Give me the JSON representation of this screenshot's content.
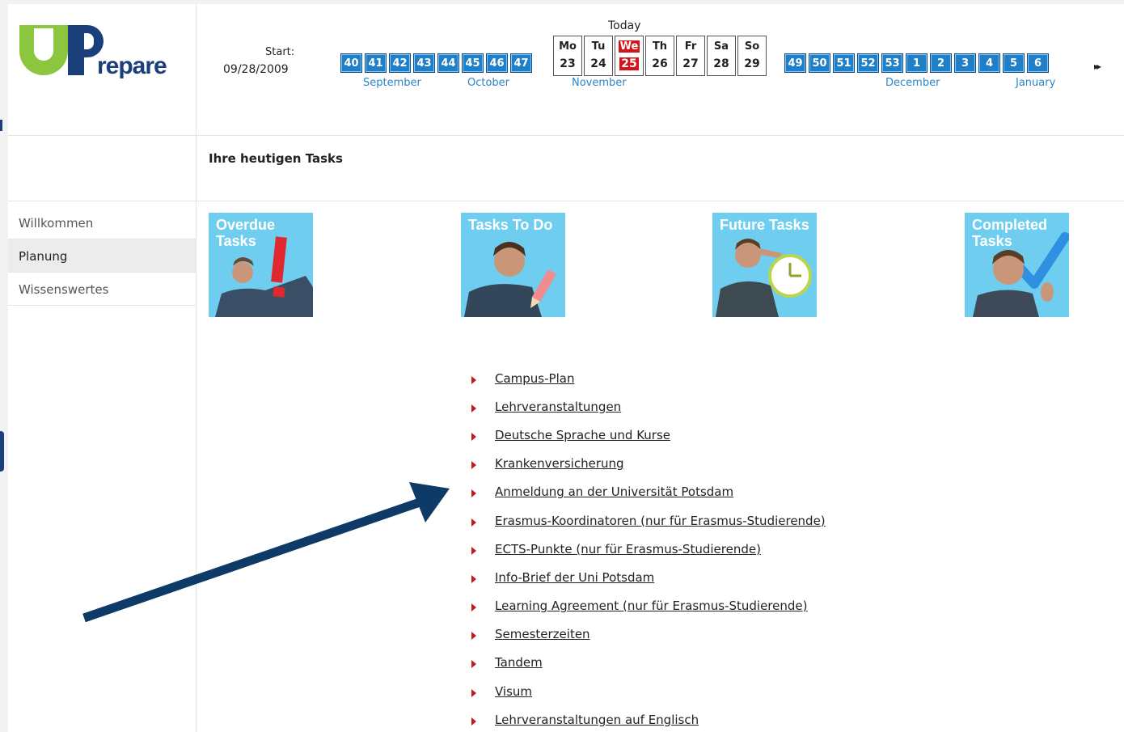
{
  "logo": {
    "letter": "UP",
    "text": "repare"
  },
  "calendar": {
    "start_label": "Start:",
    "start_date": "09/28/2009",
    "today_label": "Today",
    "weeks_before": [
      "40",
      "41",
      "42",
      "43",
      "44",
      "45",
      "46",
      "47"
    ],
    "days": [
      {
        "name": "Mo",
        "date": "23"
      },
      {
        "name": "Tu",
        "date": "24"
      },
      {
        "name": "We",
        "date": "25",
        "today": true
      },
      {
        "name": "Th",
        "date": "26"
      },
      {
        "name": "Fr",
        "date": "27"
      },
      {
        "name": "Sa",
        "date": "28"
      },
      {
        "name": "So",
        "date": "29"
      }
    ],
    "weeks_after": [
      "49",
      "50",
      "51",
      "52",
      "53",
      "1",
      "2",
      "3",
      "4",
      "5",
      "6"
    ],
    "months": [
      "September",
      "October",
      "November",
      "December",
      "January"
    ],
    "next_symbol": "▸▸"
  },
  "sidebar": {
    "items": [
      {
        "label": "Willkommen"
      },
      {
        "label": "Planung",
        "active": true
      },
      {
        "label": "Wissenswertes"
      }
    ]
  },
  "main": {
    "heading": "Ihre heutigen Tasks",
    "tiles": [
      {
        "title": "Overdue Tasks",
        "icon": "exclamation-icon"
      },
      {
        "title": "Tasks To Do",
        "icon": "pencil-icon"
      },
      {
        "title": "Future Tasks",
        "icon": "clock-icon"
      },
      {
        "title": "Completed Tasks",
        "icon": "checkmark-icon"
      }
    ],
    "links": [
      "Campus-Plan",
      "Lehrveranstaltungen",
      "Deutsche Sprache und Kurse",
      "Krankenversicherung",
      "Anmeldung an der Universität Potsdam",
      "Erasmus-Koordinatoren (nur für Erasmus-Studierende)",
      "ECTS-Punkte (nur für Erasmus-Studierende)",
      "Info-Brief der Uni Potsdam",
      "Learning Agreement (nur für Erasmus-Studierende)",
      "Semesterzeiten",
      "Tandem",
      "Visum",
      "Lehrveranstaltungen auf Englisch"
    ]
  },
  "colors": {
    "week_blue": "#1f7fc8",
    "today_red": "#d4141a",
    "tile_blue": "#6fcdf0",
    "arrow_navy": "#0d3a66"
  }
}
